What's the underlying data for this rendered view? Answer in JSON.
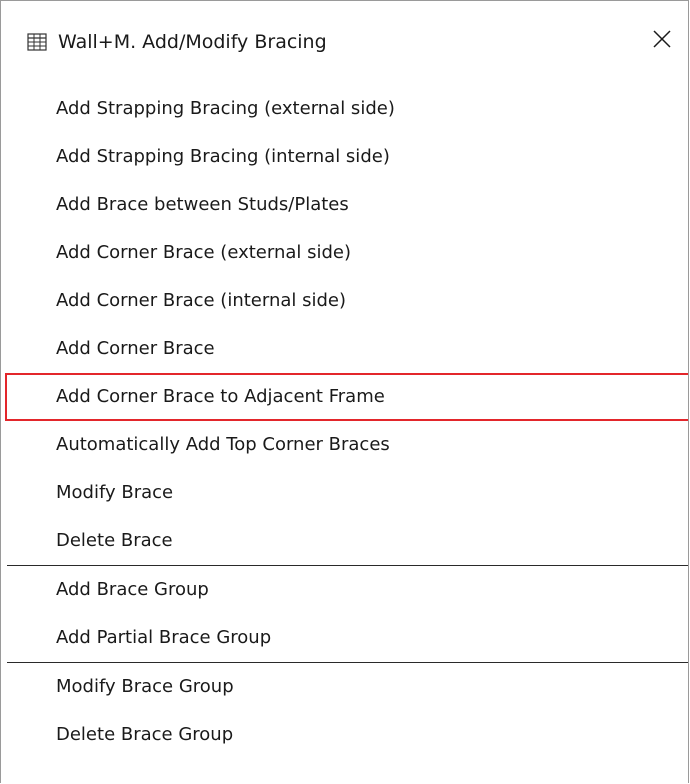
{
  "window": {
    "title": "Wall+M. Add/Modify Bracing",
    "title_icon": "grid-table-icon",
    "close_icon": "close-icon"
  },
  "menu": {
    "groups": [
      {
        "items": [
          {
            "label": "Add Strapping Bracing (external side)"
          },
          {
            "label": "Add Strapping Bracing (internal side)"
          },
          {
            "label": "Add Brace between Studs/Plates"
          },
          {
            "label": "Add Corner Brace (external side)"
          },
          {
            "label": "Add Corner Brace (internal side)"
          },
          {
            "label": "Add Corner Brace"
          },
          {
            "label": "Add Corner Brace to Adjacent Frame",
            "highlighted": true
          },
          {
            "label": "Automatically Add Top Corner Braces"
          },
          {
            "label": "Modify Brace"
          },
          {
            "label": "Delete Brace"
          }
        ]
      },
      {
        "items": [
          {
            "label": "Add Brace Group"
          },
          {
            "label": "Add Partial Brace Group"
          }
        ]
      },
      {
        "items": [
          {
            "label": "Modify Brace Group"
          },
          {
            "label": "Delete Brace Group"
          }
        ]
      }
    ]
  },
  "colors": {
    "highlight_border": "#e3262b",
    "background": "#ffffff",
    "text": "#1a1a1a"
  }
}
